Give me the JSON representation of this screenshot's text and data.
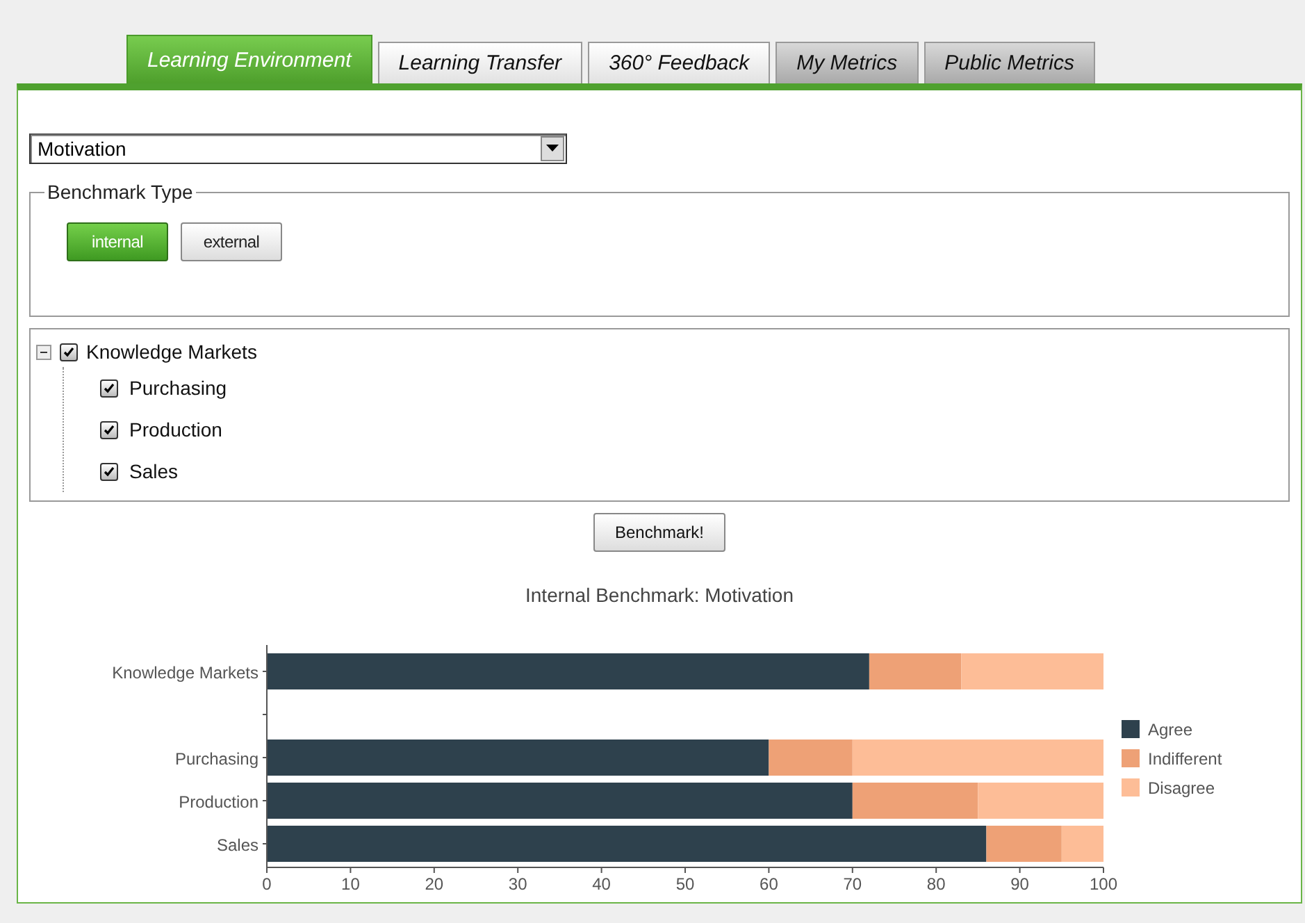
{
  "tabs": [
    {
      "label": "Learning Environment",
      "selected": true,
      "disabled": false
    },
    {
      "label": "Learning Transfer",
      "selected": false,
      "disabled": false
    },
    {
      "label": "360° Feedback",
      "selected": false,
      "disabled": false
    },
    {
      "label": "My Metrics",
      "selected": false,
      "disabled": true
    },
    {
      "label": "Public Metrics",
      "selected": false,
      "disabled": true
    }
  ],
  "dropdown": {
    "value": "Motivation"
  },
  "benchmark_type": {
    "legend": "Benchmark Type",
    "options": [
      {
        "label": "internal",
        "selected": true
      },
      {
        "label": "external",
        "selected": false
      }
    ]
  },
  "tree": [
    {
      "label": "Knowledge Markets",
      "checked": true,
      "expanded": true,
      "children": [
        {
          "label": "Purchasing",
          "checked": true
        },
        {
          "label": "Production",
          "checked": true
        },
        {
          "label": "Sales",
          "checked": true
        }
      ]
    }
  ],
  "benchmark_button": "Benchmark!",
  "chart": {
    "chart_data": {
      "type": "bar",
      "orientation": "horizontal",
      "stacked": true,
      "title": "Internal Benchmark: Motivation",
      "categories": [
        "Knowledge Markets",
        "Purchasing",
        "Production",
        "Sales"
      ],
      "series": [
        {
          "name": "Agree",
          "color": "#2e414d",
          "values": [
            72,
            60,
            70,
            86
          ]
        },
        {
          "name": "Indifferent",
          "color": "#eea176",
          "values": [
            11,
            10,
            15,
            9
          ]
        },
        {
          "name": "Disagree",
          "color": "#fdbd97",
          "values": [
            17,
            30,
            15,
            5
          ]
        }
      ],
      "xlim": [
        0,
        100
      ],
      "legend": "right",
      "xticks": [
        0,
        10,
        20,
        30,
        40,
        50,
        60,
        70,
        80,
        90,
        100
      ]
    }
  }
}
